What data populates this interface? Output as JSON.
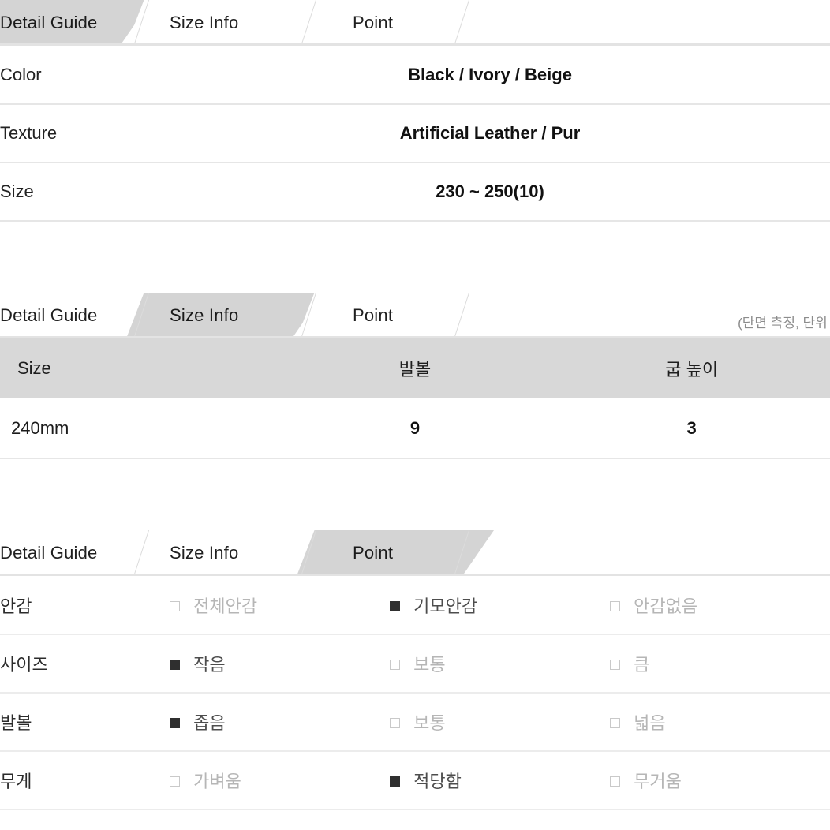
{
  "tabs": [
    {
      "label": "Detail Guide",
      "name": "tab-detail-guide"
    },
    {
      "label": "Size Info",
      "name": "tab-size-info"
    },
    {
      "label": "Point",
      "name": "tab-point"
    }
  ],
  "section_detail_guide": {
    "active_tab": "Detail Guide",
    "rows": [
      {
        "label": "Color",
        "value": "Black / Ivory / Beige"
      },
      {
        "label": "Texture",
        "value": "Artificial Leather / Pur"
      },
      {
        "label": "Size",
        "value": "230 ~ 250(10)"
      }
    ]
  },
  "section_size_info": {
    "active_tab": "Size Info",
    "note": "(단면 측정, 단위 c",
    "headers": [
      "Size",
      "발볼",
      "굽 높이"
    ],
    "rows": [
      {
        "size": "240mm",
        "ball": "9",
        "heel": "3"
      }
    ]
  },
  "section_point": {
    "active_tab": "Point",
    "rows": [
      {
        "label": "안감",
        "options": [
          {
            "text": "전체안감",
            "checked": false
          },
          {
            "text": "기모안감",
            "checked": true
          },
          {
            "text": "안감없음",
            "checked": false
          }
        ]
      },
      {
        "label": "사이즈",
        "options": [
          {
            "text": "작음",
            "checked": true
          },
          {
            "text": "보통",
            "checked": false
          },
          {
            "text": "큼",
            "checked": false
          }
        ]
      },
      {
        "label": "발볼",
        "options": [
          {
            "text": "좁음",
            "checked": true
          },
          {
            "text": "보통",
            "checked": false
          },
          {
            "text": "넓음",
            "checked": false
          }
        ]
      },
      {
        "label": "무게",
        "options": [
          {
            "text": "가벼움",
            "checked": false
          },
          {
            "text": "적당함",
            "checked": true
          },
          {
            "text": "무거움",
            "checked": false
          }
        ]
      }
    ]
  },
  "colors": {
    "active_tab_bg": "#d4d4d4",
    "header_band_bg": "#d8d8d8",
    "row_divider": "#e6e6e6",
    "checked_box": "#2f2f2f",
    "unchecked_text": "#b6b6b6",
    "checked_text": "#4d4d4d",
    "note_text": "#8c8c8c"
  },
  "glyphs": {
    "checkbox_checked": "filled-square",
    "checkbox_unchecked": "empty-square"
  }
}
